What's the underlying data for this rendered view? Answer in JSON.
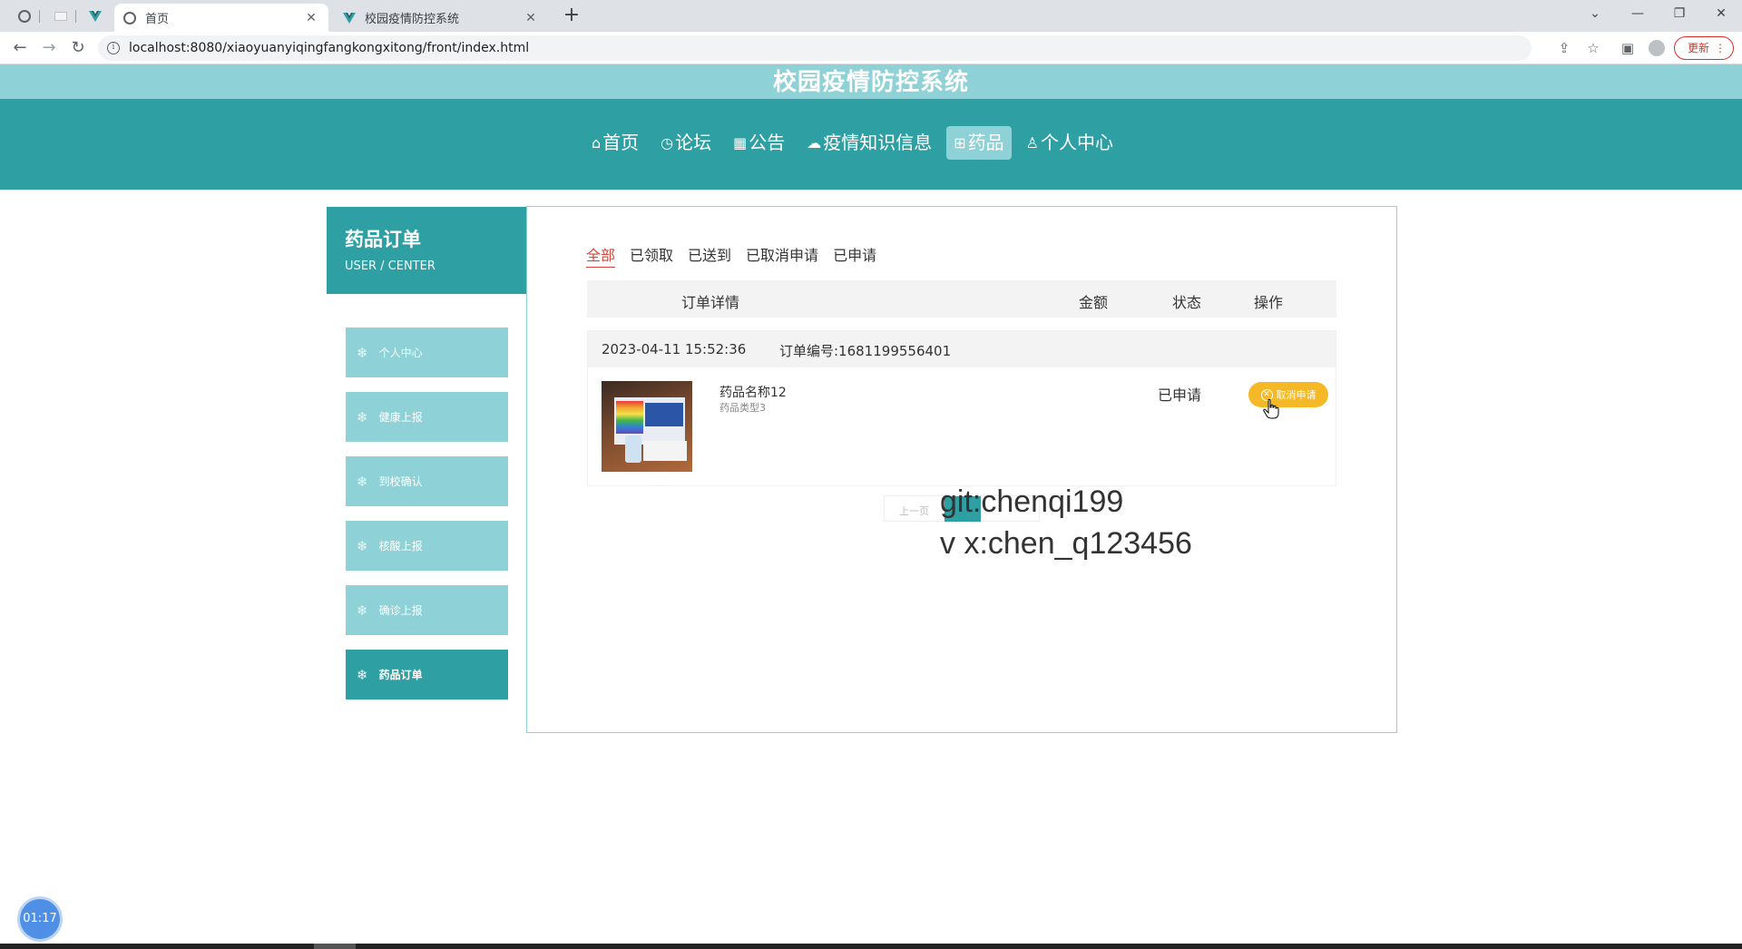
{
  "browser": {
    "tabs": [
      {
        "title": "首页",
        "active": true
      },
      {
        "title": "校园疫情防控系统",
        "active": false
      }
    ],
    "url": "localhost:8080/xiaoyuanyiqingfangkongxitong/front/index.html",
    "update_label": "更新"
  },
  "site": {
    "title": "校园疫情防控系统",
    "nav": [
      {
        "icon": "home-icon",
        "label": "首页",
        "active": false
      },
      {
        "icon": "clock-icon",
        "label": "论坛",
        "active": false
      },
      {
        "icon": "bulletin-icon",
        "label": "公告",
        "active": false
      },
      {
        "icon": "cloud-icon",
        "label": "疫情知识信息",
        "active": false
      },
      {
        "icon": "grid-icon",
        "label": "药品",
        "active": true
      },
      {
        "icon": "user-icon",
        "label": "个人中心",
        "active": false
      }
    ]
  },
  "sidebar": {
    "title": "药品订单",
    "subtitle": "USER / CENTER",
    "items": [
      {
        "label": "个人中心",
        "active": false
      },
      {
        "label": "健康上报",
        "active": false
      },
      {
        "label": "到校确认",
        "active": false
      },
      {
        "label": "核酸上报",
        "active": false
      },
      {
        "label": "确诊上报",
        "active": false
      },
      {
        "label": "药品订单",
        "active": true
      }
    ]
  },
  "orders": {
    "filter_tabs": [
      {
        "label": "全部",
        "active": true
      },
      {
        "label": "已领取",
        "active": false
      },
      {
        "label": "已送到",
        "active": false
      },
      {
        "label": "已取消申请",
        "active": false
      },
      {
        "label": "已申请",
        "active": false
      }
    ],
    "columns": {
      "detail": "订单详情",
      "amount": "金额",
      "status": "状态",
      "action": "操作"
    },
    "items": [
      {
        "datetime": "2023-04-11 15:52:36",
        "order_no": "订单编号:1681199556401",
        "product_name": "药品名称12",
        "product_type": "药品类型3",
        "status": "已申请",
        "action_label": "取消申请"
      }
    ],
    "pager": {
      "prev_label": "上一页"
    }
  },
  "overlay": {
    "line1": "git:chenqi199",
    "line2": "v x:chen_q123456",
    "timer": "01:17"
  },
  "colors": {
    "primary": "#2e9fa3",
    "light": "#8ed1d6",
    "accent_red": "#d9443b",
    "button_yellow": "#f5b927"
  }
}
